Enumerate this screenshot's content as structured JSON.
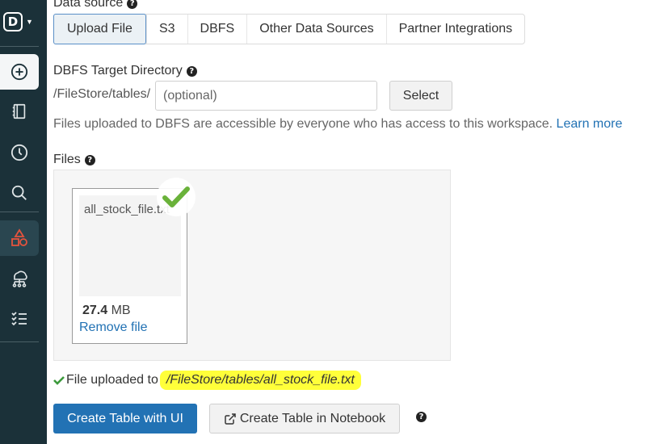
{
  "sidebar": {
    "logo_letter": "D",
    "items": [
      {
        "icon": "plus-circle-icon"
      },
      {
        "icon": "notebook-icon"
      },
      {
        "icon": "clock-icon"
      },
      {
        "icon": "search-icon"
      },
      {
        "icon": "shapes-icon"
      },
      {
        "icon": "cluster-icon"
      },
      {
        "icon": "jobs-list-icon"
      }
    ]
  },
  "data_source": {
    "label": "Data source",
    "tabs": [
      "Upload File",
      "S3",
      "DBFS",
      "Other Data Sources",
      "Partner Integrations"
    ],
    "selected_tab": "Upload File"
  },
  "dbfs": {
    "label": "DBFS Target Directory",
    "prefix": "/FileStore/tables/",
    "placeholder": "(optional)",
    "value": "",
    "select_label": "Select",
    "note": "Files uploaded to DBFS are accessible by everyone who has access to this workspace.",
    "learn_more": "Learn more"
  },
  "files": {
    "label": "Files",
    "file": {
      "name": "all_stock_file.txt",
      "size_value": "27.4",
      "size_unit": "MB",
      "remove_label": "Remove file"
    }
  },
  "status": {
    "text": "File uploaded to",
    "path": "/FileStore/tables/all_stock_file.txt"
  },
  "actions": {
    "create_ui": "Create Table with UI",
    "create_notebook": "Create Table in Notebook"
  },
  "colors": {
    "sidebar_bg": "#1b3139",
    "accent_blue": "#2272b4",
    "success_green": "#6ab23a",
    "highlight_yellow": "#ffff3a"
  }
}
